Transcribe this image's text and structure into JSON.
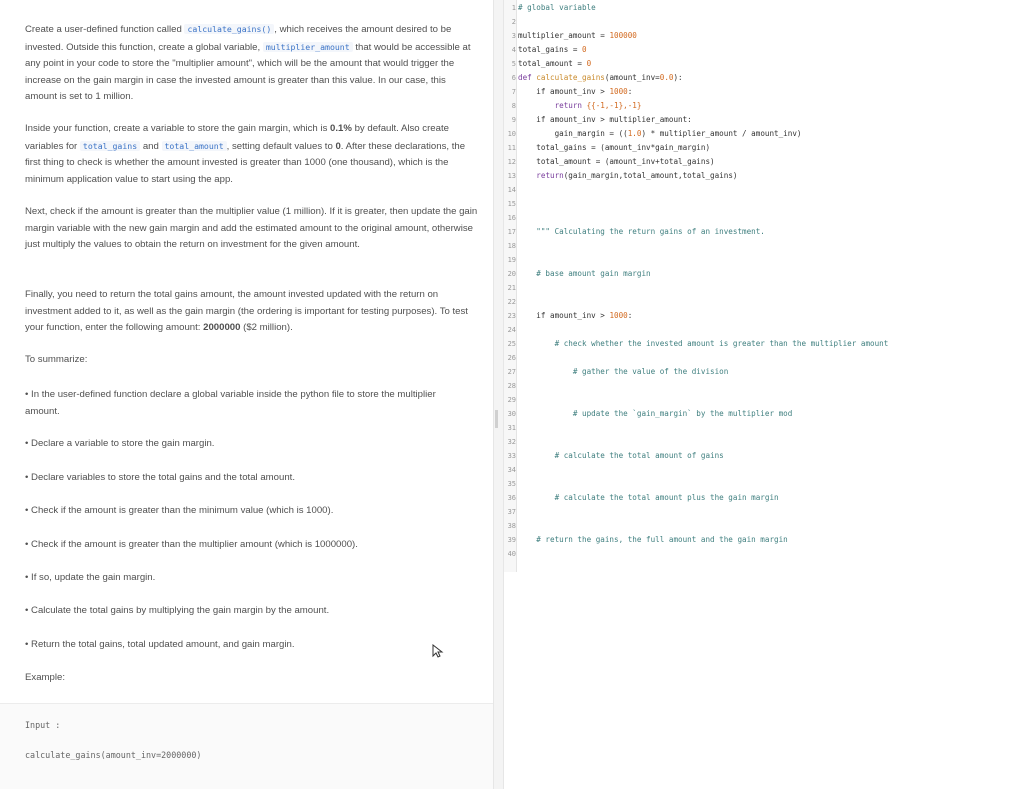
{
  "instructions": {
    "p1": {
      "t1": "Create a user-defined function called ",
      "c1": "calculate_gains()",
      "t2": ", which receives the amount desired to be invested. Outside this function, create a global variable, ",
      "c2": "multiplier_amount",
      "t3": " that would be accessible at any point in your code to store the \"multiplier amount\", which will be the amount that would trigger the increase on the gain margin in case the invested amount is greater than this value. In our case, this amount is set to 1 million."
    },
    "p2": {
      "t1": "Inside your function, create a variable to store the gain margin, which is ",
      "b1": "0.1%",
      "t2": " by default. Also create variables for ",
      "c1": "total_gains",
      "t3": " and ",
      "c2": "total_amount",
      "t4": ", setting default values to ",
      "b2": "0",
      "t5": ". After these declarations, the first thing to check is whether the amount invested is greater than 1000 (one thousand), which is the minimum application value to start using the app."
    },
    "p3": "Next, check if the amount is greater than the multiplier value (1 million). If it is greater, then update the gain margin variable with the new gain margin and add the estimated amount to the original amount, otherwise just multiply the values to obtain the return on investment for the given amount.",
    "p4": {
      "t1": "Finally, you need to return the total gains amount, the amount invested updated with the return on investment added to it, as well as the gain margin (the ordering is important for testing purposes). To test your function, enter the following amount: ",
      "b1": "2000000",
      "t2": " ($2 million)."
    },
    "summary_heading": "To summarize:",
    "bullets": [
      "• In the user-defined function declare a global variable inside the python file to store the multiplier amount.",
      "• Declare a variable to store the gain margin.",
      "• Declare variables to store the total gains and the total amount.",
      "• Check if the amount is greater than the minimum value (which is 1000).",
      "• Check if the amount is greater than the multiplier amount (which is 1000000).",
      "• If so, update the gain margin.",
      "• Calculate the total gains by multiplying the gain margin by the amount.",
      "• Return the total gains, total updated amount, and gain margin."
    ],
    "example_label": "Example:",
    "input_label": "Input :",
    "input_code": "calculate_gains(amount_inv=2000000)"
  },
  "editor": {
    "line_numbers": [
      "1",
      "2",
      "3",
      "4",
      "5",
      "6",
      "7",
      "8",
      "9",
      "10",
      "11",
      "12",
      "13",
      "14",
      "15",
      "16",
      "17",
      "18",
      "19",
      "20",
      "21",
      "22",
      "23",
      "24",
      "25",
      "26",
      "27",
      "28",
      "29",
      "30",
      "31",
      "32",
      "33",
      "34",
      "35",
      "36",
      "37",
      "38",
      "39",
      "40"
    ],
    "l1": "# global variable",
    "l3a": "multiplier_amount = ",
    "l3b": "100000",
    "l4a": "total_gains = ",
    "l4b": "0",
    "l5a": "total_amount = ",
    "l5b": "0",
    "l6a": "def ",
    "l6b": "calculate_gains",
    "l6c": "(amount_inv=",
    "l6d": "0.0",
    "l6e": "):",
    "l7a": "    if amount_inv > ",
    "l7b": "1000",
    "l7c": ":",
    "l8a": "        return ",
    "l8b": "{{-1,-1},-1}",
    "l9a": "    if amount_inv > multiplier_amount:",
    "l10a": "        gain_margin = ((",
    "l10b": "1.0",
    "l10c": ") * multiplier_amount / amount_inv)",
    "l11": "    total_gains = (amount_inv*gain_margin)",
    "l12": "    total_amount = (amount_inv+total_gains)",
    "l13a": "    ",
    "l13b": "return",
    "l13c": "(gain_margin,total_amount,total_gains)",
    "l17": "    \"\"\" Calculating the return gains of an investment.",
    "l20": "    # base amount gain margin",
    "l23a": "    if amount_inv > ",
    "l23b": "1000",
    "l23c": ":",
    "l25": "        # check whether the invested amount is greater than the multiplier amount",
    "l27": "            # gather the value of the division",
    "l30": "            # update the `gain_margin` by the multiplier mod",
    "l33": "        # calculate the total amount of gains",
    "l36": "        # calculate the total amount plus the gain margin",
    "l39": "    # return the gains, the full amount and the gain margin"
  },
  "colors": {
    "inline_code": "#3b73c6",
    "keyword": "#7a3e9d",
    "function": "#c98a2b",
    "number": "#d2691e",
    "comment": "#3f7f7f"
  },
  "icons": {
    "cursor": "mouse-pointer-icon"
  }
}
